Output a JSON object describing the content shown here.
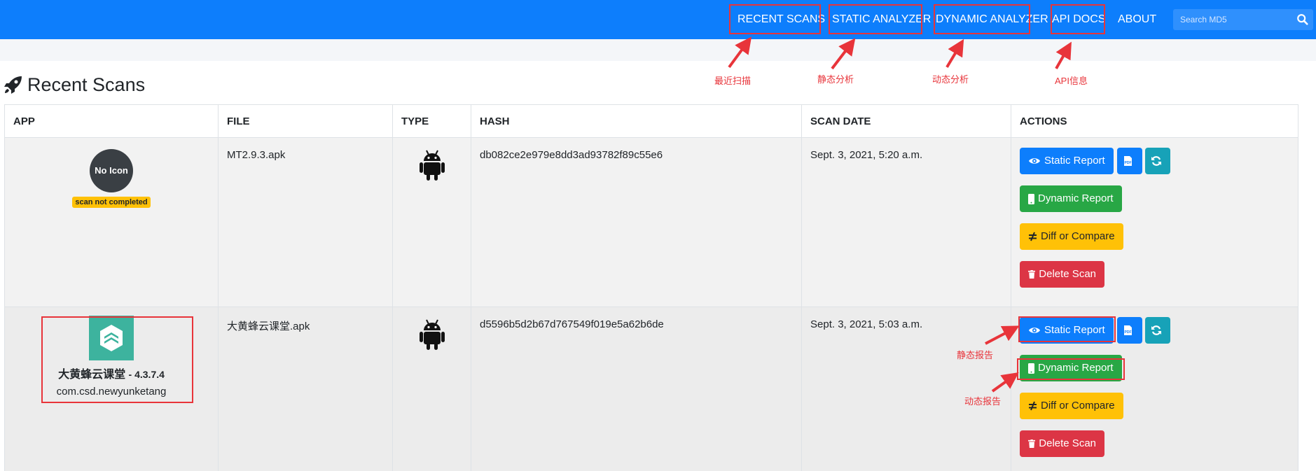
{
  "nav": {
    "links": [
      "RECENT SCANS",
      "STATIC ANALYZER",
      "DYNAMIC ANALYZER",
      "API DOCS",
      "ABOUT"
    ],
    "search_placeholder": "Search MD5"
  },
  "page": {
    "title": "Recent Scans"
  },
  "table": {
    "headers": [
      "APP",
      "FILE",
      "TYPE",
      "HASH",
      "SCAN DATE",
      "ACTIONS"
    ],
    "rows": [
      {
        "icon_text": "No Icon",
        "badge": "scan not completed",
        "file": "MT2.9.3.apk",
        "hash": "db082ce2e979e8dd3ad93782f89c55e6",
        "date": "Sept. 3, 2021, 5:20 a.m."
      },
      {
        "app_name": "大黄蜂云课堂",
        "version": "- 4.3.7.4",
        "package": "com.csd.newyunketang",
        "file": "大黄蜂云课堂.apk",
        "hash": "d5596b5d2b67d767549f019e5a62b6de",
        "date": "Sept. 3, 2021, 5:03 a.m."
      }
    ]
  },
  "actions": {
    "static": "Static Report",
    "dynamic": "Dynamic Report",
    "diff": "Diff or Compare",
    "delete": "Delete Scan"
  },
  "annotations": {
    "recent_scans": "最近扫描",
    "static_analyzer": "静态分析",
    "dynamic_analyzer": "动态分析",
    "api_docs": "API信息",
    "static_report": "静态报告",
    "dynamic_report": "动态报告"
  },
  "colors": {
    "navbar": "#0d7efc",
    "primary": "#0d7efc",
    "success": "#28a745",
    "warning": "#ffc107",
    "danger": "#dc3545",
    "info": "#17a2b8",
    "annotation": "#e8343a"
  }
}
